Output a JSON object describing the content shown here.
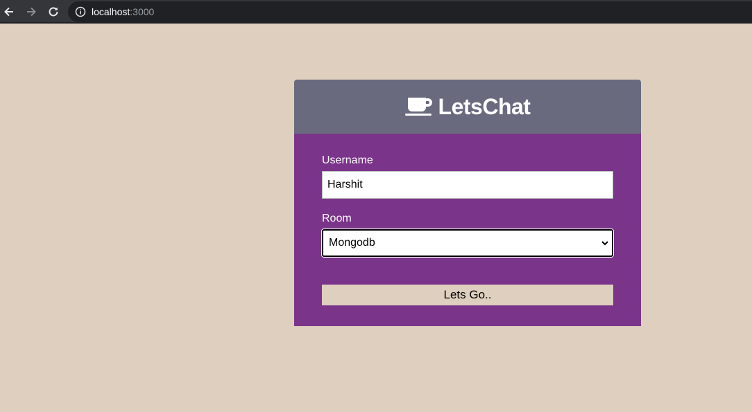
{
  "browser": {
    "url_host": "localhost",
    "url_port": ":3000"
  },
  "app": {
    "icon": "coffee-cup-icon",
    "title": "LetsChat"
  },
  "form": {
    "username_label": "Username",
    "username_value": "Harshit",
    "room_label": "Room",
    "room_selected": "Mongodb",
    "submit_label": "Lets Go.."
  },
  "colors": {
    "page_bg": "#dfcfbf",
    "header_bg": "#696a7e",
    "body_bg": "#7a3489",
    "button_bg": "#dfcfbf"
  }
}
